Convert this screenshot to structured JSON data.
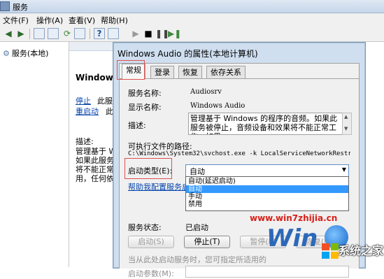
{
  "window": {
    "title": "服务",
    "menu": [
      "文件(F)",
      "操作(A)",
      "查看(V)",
      "帮助(H)"
    ]
  },
  "toolbar": {
    "back_icon": "back-arrow-icon",
    "forward_icon": "forward-arrow-icon",
    "help_label": "?"
  },
  "tree": {
    "root": "服务(本地)"
  },
  "detail": {
    "service_name": "Windows",
    "stop_link": "停止",
    "stop_rest": "此服务",
    "restart_link": "重启动",
    "restart_rest": "此服",
    "description_label": "描述:",
    "description_lines": [
      "管理基于 W",
      "如果此服务",
      "将不能正常",
      "用，任何依"
    ]
  },
  "dialog": {
    "title": "Windows Audio 的属性(本地计算机)",
    "tabs": [
      "常规",
      "登录",
      "恢复",
      "依存关系"
    ],
    "active_tab": 0,
    "service_name_label": "服务名称:",
    "service_name_value": "Audiosrv",
    "display_name_label": "显示名称:",
    "display_name_value": "Windows Audio",
    "description_label": "描述:",
    "description_value": "管理基于 Windows 的程序的音频。如果此服务被停止，音频设备和效果将不能正常工作。如果",
    "path_label": "可执行文件的路径:",
    "path_value": "C:\\Windows\\System32\\svchost.exe -k LocalServiceNetworkRestri",
    "startup_type_label": "启动类型(E):",
    "startup_type_value": "自动",
    "startup_options": [
      "自动(延迟启动)",
      "自动",
      "手动",
      "禁用"
    ],
    "startup_selected": 1,
    "help_link": "帮助我配置服务启动",
    "status_label": "服务状态:",
    "status_value": "已启动",
    "buttons": {
      "start": "启动(S)",
      "stop": "停止(T)",
      "pause": "暂停(P)",
      "resume": "恢复(R)"
    },
    "hint": "当从此处启动服务时，您可指定所适用的",
    "start_params_label": "启动参数(M):"
  },
  "watermark": {
    "url": "www.win7zhijia.cn",
    "logo": "Win",
    "brand": "系统之家"
  }
}
